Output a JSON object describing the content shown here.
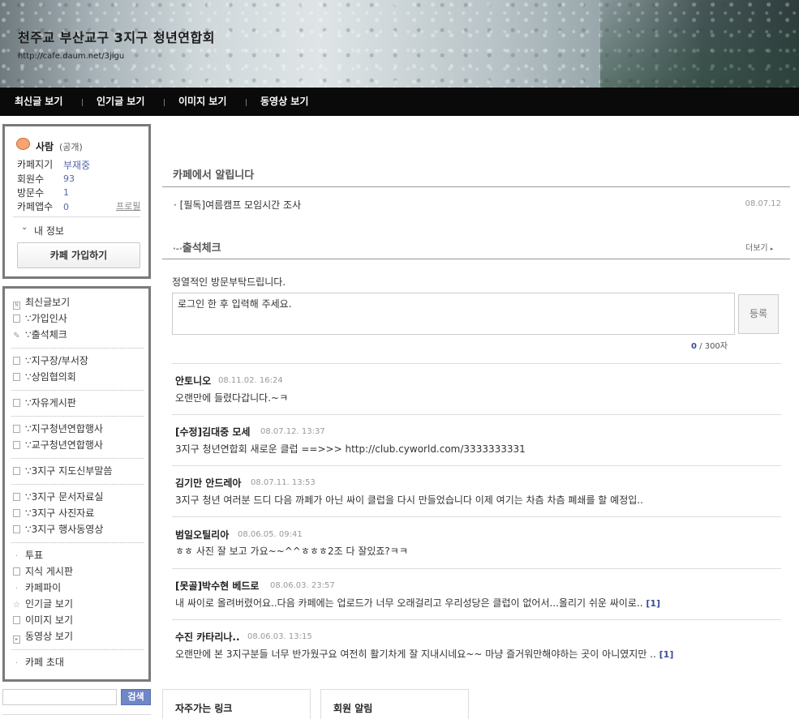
{
  "header": {
    "title": "천주교 부산교구 3지구 청년연합회",
    "url": "http://cafe.daum.net/3jigu"
  },
  "nav": [
    {
      "label": "최신글 보기"
    },
    {
      "label": "인기글 보기"
    },
    {
      "label": "이미지 보기"
    },
    {
      "label": "동영상 보기"
    }
  ],
  "profile": {
    "name": "사람",
    "visibility": "(공개)",
    "rows": [
      {
        "label": "카페지기",
        "value": "부재중"
      },
      {
        "label": "회원수",
        "value": "93"
      },
      {
        "label": "방문수",
        "value": "1"
      },
      {
        "label": "카페앱수",
        "value": "0"
      }
    ],
    "profile_link": "프로필",
    "my_info": "내 정보",
    "join_label": "카페 가입하기"
  },
  "menu": {
    "items": [
      {
        "label": "최신글보기",
        "icon": "new-icon"
      },
      {
        "label": "∵가입인사",
        "icon": "board-icon"
      },
      {
        "label": "∵출석체크",
        "icon": "pencil-icon"
      },
      {
        "label": "∵지구장/부서장",
        "icon": "board-icon"
      },
      {
        "label": "∵상임협의회",
        "icon": "board-icon"
      },
      {
        "label": "∵자유게시판",
        "icon": "board-icon"
      },
      {
        "label": "∵지구청년연합행사",
        "icon": "board-icon"
      },
      {
        "label": "∵교구청년연합행사",
        "icon": "board-icon"
      },
      {
        "label": "∵3지구 지도신부말씀",
        "icon": "board-icon"
      },
      {
        "label": "∵3지구 문서자료실",
        "icon": "board-icon"
      },
      {
        "label": "∵3지구 사진자료",
        "icon": "photo-board-icon"
      },
      {
        "label": "∵3지구 행사동영상",
        "icon": "board-icon"
      },
      {
        "label": "투표",
        "icon": "dot-icon"
      },
      {
        "label": "지식 게시판",
        "icon": "knowledge-icon"
      },
      {
        "label": "카페파이",
        "icon": "dot-icon"
      },
      {
        "label": "인기글 보기",
        "icon": "star-icon"
      },
      {
        "label": "이미지 보기",
        "icon": "image-icon"
      },
      {
        "label": "동영상 보기",
        "icon": "video-icon"
      },
      {
        "label": "카페 초대",
        "icon": "dot-icon"
      }
    ]
  },
  "search": {
    "button": "검색",
    "placeholder": ""
  },
  "notice": {
    "title": "카페에서 알립니다",
    "items": [
      {
        "text": "[필독]여름캠프 모임시간 조사",
        "date": "08.07.12"
      }
    ]
  },
  "attendance": {
    "title": "출석체크",
    "more": "더보기",
    "message": "정열적인 방문부탁드립니다.",
    "input_placeholder": "로그인 한 후 입력해 주세요.",
    "submit": "등록",
    "count": "0",
    "limit": "/ 300자",
    "comments": [
      {
        "author": "안토니오",
        "date": "08.11.02. 16:24",
        "text": "오랜만에 들렸다갑니다.~ㅋ",
        "more": ""
      },
      {
        "author": "[수정]김대중 모세",
        "date": "08.07.12. 13:37",
        "text": "3지구 청년연합회 새로운 클럽 ==>>> http://club.cyworld.com/3333333331",
        "more": ""
      },
      {
        "author": "김기만 안드레아",
        "date": "08.07.11. 13:53",
        "text": "3지구 청년 여러분 드디 다음 까페가 아닌 싸이 클럽을 다시 만들었습니다 이제 여기는 차츰 차츰 폐쇄를 할 예정입..",
        "more": ""
      },
      {
        "author": "범일오틸리아",
        "date": "08.06.05. 09:41",
        "text": "ㅎㅎ 사진 잘 보고 가요~~^^ㅎㅎㅎ2조 다 잘있죠?ㅋㅋ",
        "more": ""
      },
      {
        "author": "[못골]박수현 베드로",
        "date": "08.06.03. 23:57",
        "text": "내 싸이로 올려버렸어요..다음 카페에는 업로드가 너무 오래걸리고 우리성당은 클럽이 없어서...올리기 쉬운 싸이로..",
        "more": "[1]"
      },
      {
        "author": "수진 카타리나..",
        "date": "08.06.03. 13:15",
        "text": "오랜만에 본 3지구분들 너무 반가웠구요 여전히 활기차게 잘 지내시네요~~ 마냥 즐거워만해야하는 곳이 아니였지만 ..",
        "more": "[1]"
      }
    ]
  },
  "bottom": {
    "links_title": "자주가는 링크",
    "members_title": "회원 알림"
  },
  "colors": {
    "nav_bg": "#0a0a0a",
    "accent": "#3a4c9a",
    "search_btn": "#6f87c6"
  }
}
